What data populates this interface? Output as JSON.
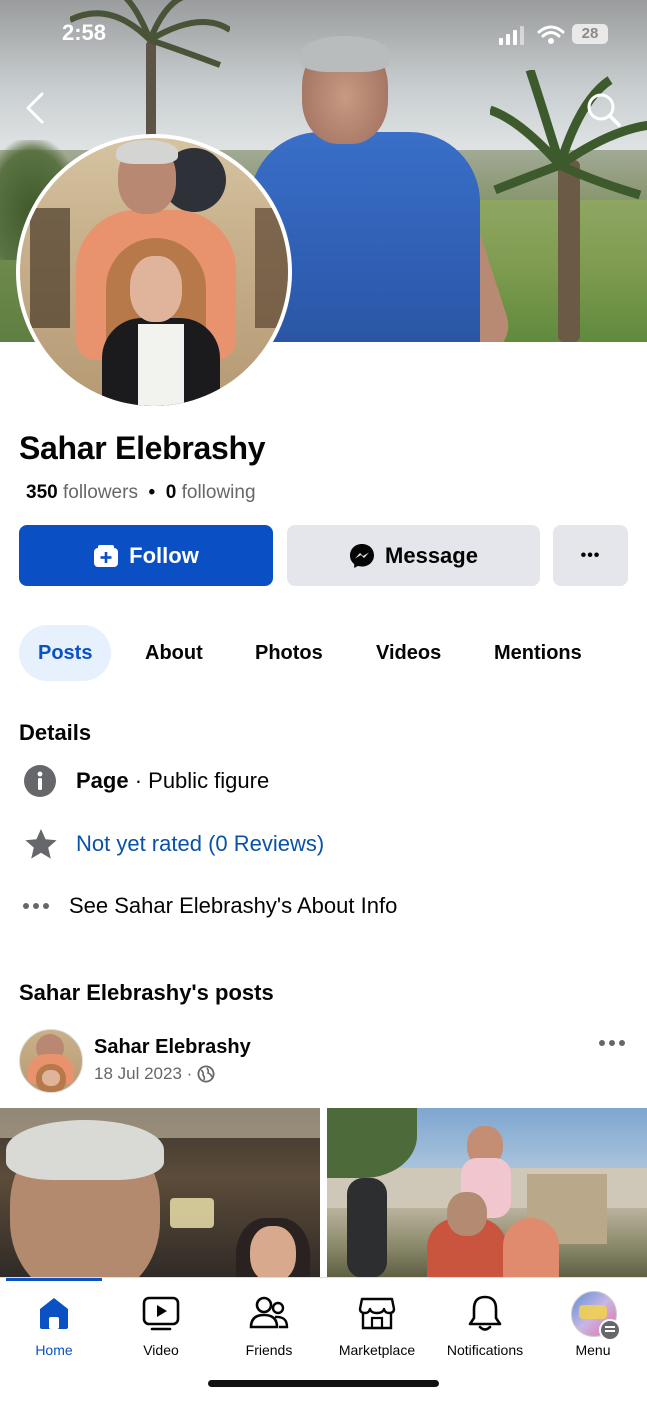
{
  "status_bar": {
    "time": "2:58",
    "battery": "28"
  },
  "profile": {
    "name": "Sahar Elebrashy",
    "followers_count": "350",
    "followers_label": "followers",
    "separator": "•",
    "following_count": "0",
    "following_label": "following"
  },
  "actions": {
    "follow_label": "Follow",
    "message_label": "Message",
    "more_label": "•••"
  },
  "tabs": [
    {
      "label": "Posts",
      "active": true
    },
    {
      "label": "About"
    },
    {
      "label": "Photos"
    },
    {
      "label": "Videos"
    },
    {
      "label": "Mentions"
    }
  ],
  "details": {
    "title": "Details",
    "page_label": "Page",
    "page_category": " · Public figure",
    "rating": "Not yet rated (0 Reviews)",
    "about_link": "See Sahar Elebrashy's About Info"
  },
  "posts_section": {
    "title": "Sahar Elebrashy's posts",
    "post": {
      "author": "Sahar Elebrashy",
      "date": "18 Jul 2023 ·"
    }
  },
  "bottom_nav": [
    {
      "label": "Home",
      "icon": "home-icon",
      "active": true
    },
    {
      "label": "Video",
      "icon": "video-icon"
    },
    {
      "label": "Friends",
      "icon": "friends-icon"
    },
    {
      "label": "Marketplace",
      "icon": "marketplace-icon"
    },
    {
      "label": "Notifications",
      "icon": "bell-icon"
    },
    {
      "label": "Menu",
      "icon": "menu-avatar"
    }
  ],
  "colors": {
    "accent": "#0a4fc3",
    "link": "#0a52a8",
    "tab_active_bg": "#e7f0fd"
  }
}
